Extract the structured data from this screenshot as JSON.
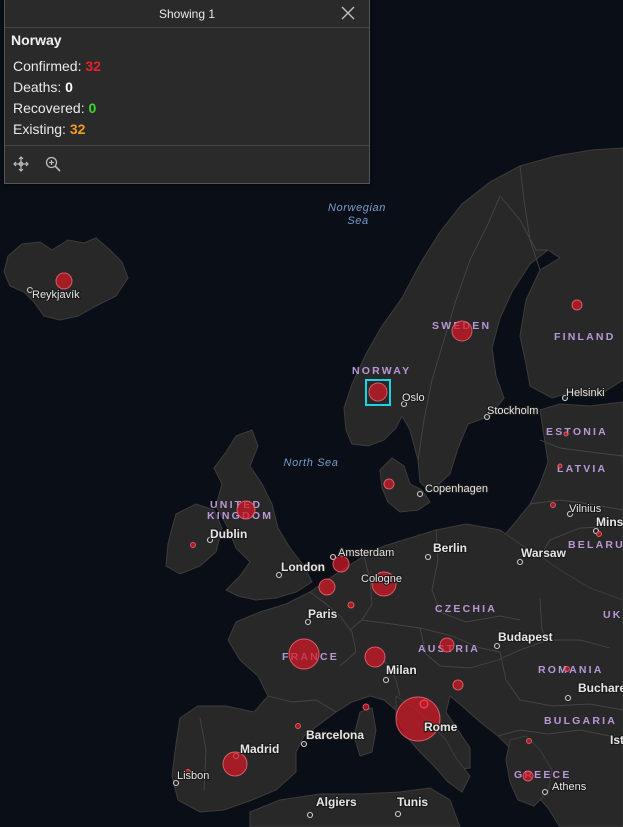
{
  "popup": {
    "header": "Showing 1",
    "title": "Norway",
    "confirmed_label": "Confirmed:",
    "confirmed_value": "32",
    "deaths_label": "Deaths:",
    "deaths_value": "0",
    "recovered_label": "Recovered:",
    "recovered_value": "0",
    "existing_label": "Existing:",
    "existing_value": "32",
    "actions": [
      "move-icon",
      "zoom-to-icon"
    ],
    "close_icon": "close-icon"
  },
  "colors": {
    "confirmed": "#e8202c",
    "recovered": "#38d82d",
    "existing": "#f49a1c",
    "selection": "#19d4e6",
    "bubble": "#d21826"
  },
  "map": {
    "seas": [
      "Norwegian Sea",
      "North Sea"
    ],
    "countries": [
      "SWEDEN",
      "FINLAND",
      "NORWAY",
      "ESTONIA",
      "LATVIA",
      "UNITED KINGDOM",
      "BELARUS",
      "CZECHIA",
      "FRANCE",
      "AUSTRIA",
      "ROMANIA",
      "BULGARIA",
      "GREECE",
      "UK"
    ],
    "cities": [
      "Reykjavík",
      "Oslo",
      "Stockholm",
      "Helsinki",
      "Copenhagen",
      "Dublin",
      "Vilnius",
      "Minsk",
      "London",
      "Amsterdam",
      "Berlin",
      "Warsaw",
      "Cologne",
      "Paris",
      "Budapest",
      "Milan",
      "Bucharest",
      "Rome",
      "Barcelona",
      "Madrid",
      "Lisbon",
      "Istanbul",
      "Athens",
      "Algiers",
      "Tunis"
    ]
  }
}
